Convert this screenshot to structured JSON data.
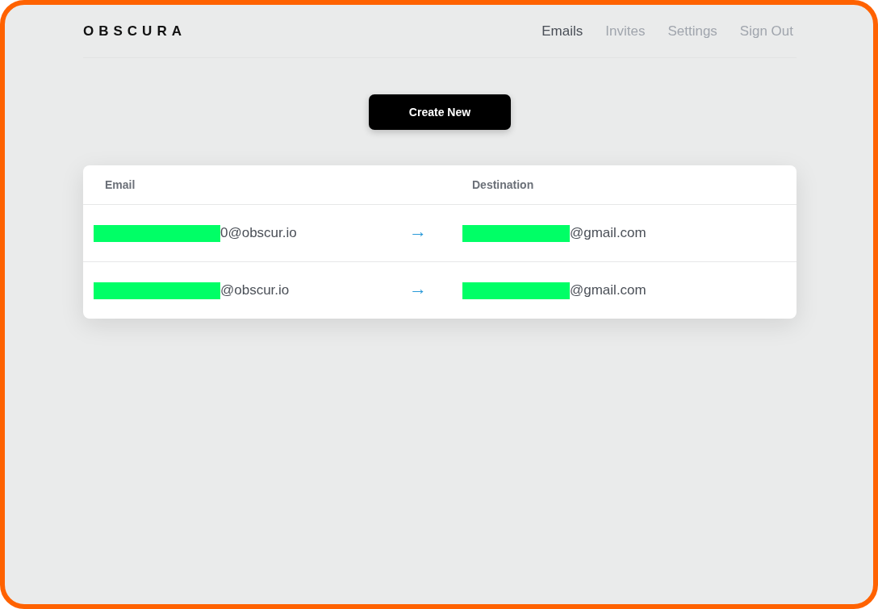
{
  "brand": "OBSCURA",
  "nav": [
    {
      "label": "Emails",
      "selected": true
    },
    {
      "label": "Invites",
      "selected": false
    },
    {
      "label": "Settings",
      "selected": false
    },
    {
      "label": "Sign Out",
      "selected": false
    }
  ],
  "create_button": "Create New",
  "table": {
    "columns": [
      "Email",
      "Destination"
    ],
    "rows": [
      {
        "email": {
          "redacted": true,
          "text": "0@obscur.io"
        },
        "arrow": "→",
        "destination": {
          "redacted": true,
          "text": "@gmail.com"
        }
      },
      {
        "email": {
          "redacted": true,
          "text": "@obscur.io"
        },
        "arrow": "→",
        "destination": {
          "redacted": true,
          "text": "@gmail.com"
        }
      }
    ]
  }
}
